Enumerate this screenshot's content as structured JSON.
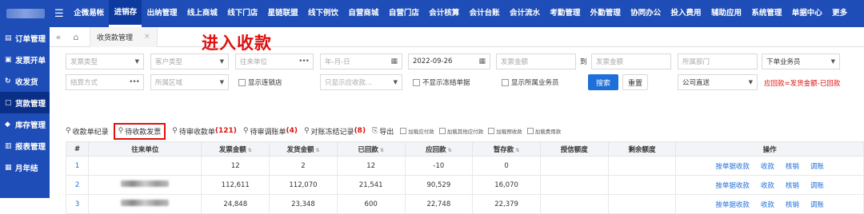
{
  "topnav": {
    "menu_icon": "menu-icon",
    "items": [
      "企微易帐",
      "进销存",
      "出纳管理",
      "线上商城",
      "线下门店",
      "星链联盟",
      "线下例饮",
      "自营商城",
      "自营门店",
      "会计核算",
      "会计台账",
      "会计流水",
      "考勤管理",
      "外勤管理",
      "协同办公",
      "投入费用",
      "辅助应用",
      "系统管理",
      "单据中心",
      "更多"
    ],
    "active_index": 1
  },
  "sidebar": {
    "items": [
      {
        "icon": "order-icon",
        "label": "订单管理"
      },
      {
        "icon": "invoice-icon",
        "label": "发票开单"
      },
      {
        "icon": "delivery-icon",
        "label": "收发货"
      },
      {
        "icon": "payment-icon",
        "label": "货款管理"
      },
      {
        "icon": "warehouse-icon",
        "label": "库存管理"
      },
      {
        "icon": "report-icon",
        "label": "报表管理"
      },
      {
        "icon": "calendar-icon",
        "label": "月年结"
      }
    ],
    "active_index": 3
  },
  "tabs": {
    "collapse_icon": "«",
    "home_icon": "home-icon",
    "items": [
      {
        "label": "收货款管理",
        "close": "×"
      }
    ]
  },
  "annotation": "进入收款",
  "filters": {
    "row1": {
      "invoice_type": "发票类型",
      "customer_type": "客户类型",
      "partner": "往来单位",
      "date_from": "年-月-日",
      "date_to": "2022-09-26",
      "amount_from": "发票金额",
      "range_sep": "到",
      "amount_to": "发票金额",
      "department": "所属部门",
      "salesperson": "下单业务员"
    },
    "row2": {
      "settle_method": "结算方式",
      "region": "所属区域",
      "show_chain_store": "显示连锁店",
      "show_receivable": "只显示应收款...",
      "hide_frozen": "不显示冻结单据",
      "show_my_clerk": "显示所属业务员",
      "search": "搜索",
      "reset": "重置",
      "company": "公司直送",
      "formula": "应回款=发货金额-已回款"
    }
  },
  "toolbar": {
    "items": [
      {
        "label": "收款单纪录",
        "count": ""
      },
      {
        "label": "待收款发票",
        "count": ""
      },
      {
        "label": "待审收款单",
        "count": "(121)"
      },
      {
        "label": "待审调账单",
        "count": "(4)"
      },
      {
        "label": "对账冻结记录",
        "count": "(8)"
      }
    ],
    "export": "导出",
    "checks": [
      "加载应付款",
      "加载其他应付款",
      "加载预收款",
      "加载费用款"
    ]
  },
  "table": {
    "headers": [
      "#",
      "往来单位",
      "发票金额",
      "发货金额",
      "已回款",
      "应回款",
      "暂存款",
      "授信额度",
      "剩余额度",
      "操作"
    ],
    "rows": [
      {
        "no": "1",
        "partner": "",
        "invoice": "12",
        "shipped": "2",
        "received": "12",
        "due": "-10",
        "temp": "0",
        "credit": "",
        "remain": ""
      },
      {
        "no": "2",
        "partner": "blurred",
        "invoice": "112,611",
        "shipped": "112,070",
        "received": "21,541",
        "due": "90,529",
        "temp": "16,070",
        "credit": "",
        "remain": ""
      },
      {
        "no": "3",
        "partner": "blurred",
        "invoice": "24,848",
        "shipped": "23,348",
        "received": "600",
        "due": "22,748",
        "temp": "22,379",
        "credit": "",
        "remain": ""
      }
    ],
    "ops": [
      "按单据收款",
      "收款",
      "核销",
      "调账"
    ]
  },
  "colors": {
    "brand": "#1e4db7",
    "active_nav": "#0a2f86",
    "link": "#1e6fd9",
    "alert": "#e01010"
  }
}
